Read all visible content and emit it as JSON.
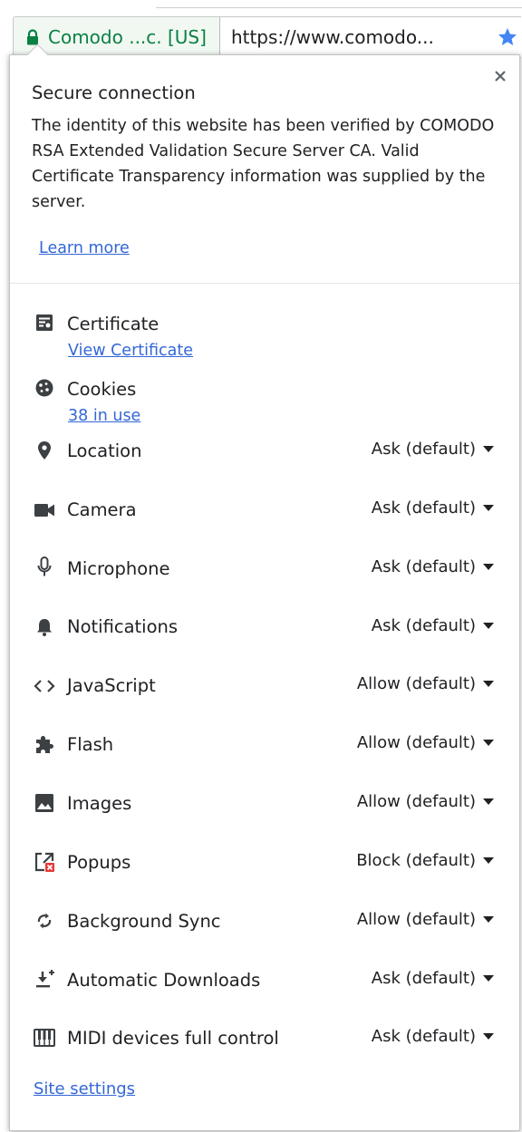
{
  "omnibox": {
    "ev_label": "Comodo ...c. [US]",
    "url": "https://www.comodo..."
  },
  "popup": {
    "title": "Secure connection",
    "description": "The identity of this website has been verified by COMODO RSA Extended Validation Secure Server CA. Valid Certificate Transparency information was supplied by the server.",
    "learn_more": "Learn more",
    "certificate": {
      "label": "Certificate",
      "link": "View Certificate"
    },
    "cookies": {
      "label": "Cookies",
      "link": "38 in use"
    },
    "permissions": [
      {
        "label": "Location",
        "value": "Ask (default)",
        "icon": "location-pin-icon"
      },
      {
        "label": "Camera",
        "value": "Ask (default)",
        "icon": "camera-icon"
      },
      {
        "label": "Microphone",
        "value": "Ask (default)",
        "icon": "microphone-icon"
      },
      {
        "label": "Notifications",
        "value": "Ask (default)",
        "icon": "bell-icon"
      },
      {
        "label": "JavaScript",
        "value": "Allow (default)",
        "icon": "code-brackets-icon"
      },
      {
        "label": "Flash",
        "value": "Allow (default)",
        "icon": "puzzle-piece-icon"
      },
      {
        "label": "Images",
        "value": "Allow (default)",
        "icon": "image-icon"
      },
      {
        "label": "Popups",
        "value": "Block (default)",
        "icon": "popup-blocked-icon"
      },
      {
        "label": "Background Sync",
        "value": "Allow (default)",
        "icon": "sync-icon"
      },
      {
        "label": "Automatic Downloads",
        "value": "Ask (default)",
        "icon": "download-icon"
      },
      {
        "label": "MIDI devices full control",
        "value": "Ask (default)",
        "icon": "piano-keys-icon"
      }
    ],
    "site_settings": "Site settings"
  },
  "colors": {
    "secure_green": "#0b8043",
    "link_blue": "#3367d6",
    "star_blue": "#4285f4"
  }
}
